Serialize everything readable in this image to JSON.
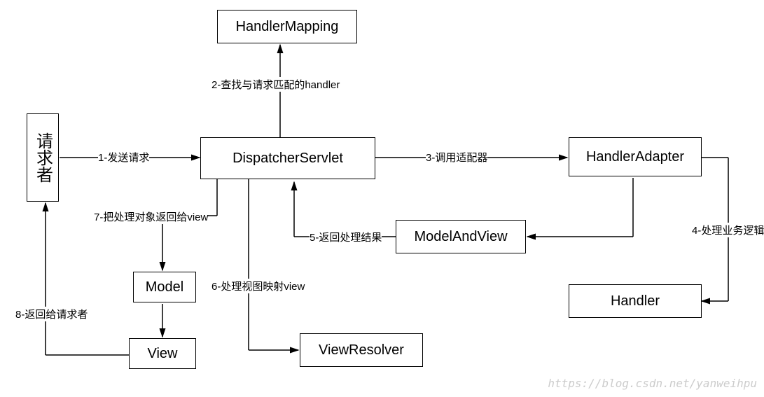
{
  "nodes": {
    "requester": "请求者",
    "handlerMapping": "HandlerMapping",
    "dispatcherServlet": "DispatcherServlet",
    "handlerAdapter": "HandlerAdapter",
    "modelAndView": "ModelAndView",
    "handler": "Handler",
    "model": "Model",
    "view": "View",
    "viewResolver": "ViewResolver"
  },
  "edges": {
    "e1": "1-发送请求",
    "e2": "2-查找与请求匹配的handler",
    "e3": "3-调用适配器",
    "e4": "4-处理业务逻辑",
    "e5": "5-返回处理结果",
    "e6": "6-处理视图映射view",
    "e7": "7-把处理对象返回给view",
    "e8": "8-返回给请求者"
  },
  "watermark": "https://blog.csdn.net/yanweihpu"
}
